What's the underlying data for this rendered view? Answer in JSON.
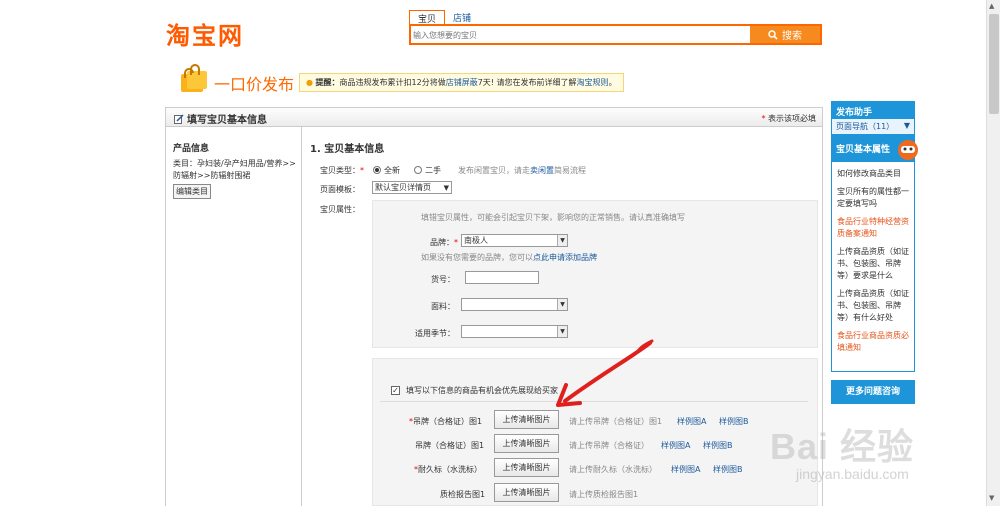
{
  "header": {
    "logo": "淘宝网",
    "tabs": [
      "宝贝",
      "店铺"
    ],
    "search_placeholder": "输入您想要的宝贝",
    "search_button": "搜索"
  },
  "title_bar": {
    "page_title": "一口价发布",
    "notice_bold": "提醒：",
    "notice_text1": "商品违规发布累计扣12分将做",
    "notice_link1": "店铺屏蔽",
    "notice_text2": "7天! 请您在发布前详细了解",
    "notice_link2": "淘宝规则",
    "notice_text3": "。"
  },
  "panel": {
    "title": "填写宝贝基本信息",
    "required_note": "表示该项必填"
  },
  "left": {
    "title": "产品信息",
    "category": "类目：孕妇装/孕产妇用品/营养>>防辐射>>防辐射围裙",
    "edit_button": "编辑类目"
  },
  "form": {
    "section_title": "1. 宝贝基本信息",
    "type_label": "宝贝类型：",
    "type_new": "全新",
    "type_used": "二手",
    "type_hint1": "发布闲置宝贝，请走",
    "type_hint_link": "卖闲置",
    "type_hint2": "简易流程",
    "template_label": "页面模板：",
    "template_value": "默认宝贝详情页",
    "attr_label": "宝贝属性：",
    "attr_hint": "填错宝贝属性，可能会引起宝贝下架，影响您的正常销售。请认真准确填写",
    "brand_label": "品牌：",
    "brand_value": "南极人",
    "brand_hint1": "如果没有您需要的品牌，您可以",
    "brand_hint_link": "点此申请添加品牌",
    "sku_label": "货号：",
    "fabric_label": "面料：",
    "season_label": "适用季节：",
    "priority_label": "填写以下信息的商品有机会优先展现给买家",
    "uploads": [
      {
        "label": "吊牌（合格证）图1",
        "required": true,
        "button": "上传清晰图片",
        "hint": "请上传吊牌（合格证）图1",
        "ex_a": "样例图A",
        "ex_b": "样例图B"
      },
      {
        "label": "吊牌（合格证）图1",
        "required": false,
        "button": "上传清晰图片",
        "hint": "请上传吊牌（合格证）",
        "ex_a": "样例图A",
        "ex_b": "样例图B"
      },
      {
        "label": "耐久标（水洗标）",
        "required": true,
        "button": "上传清晰图片",
        "hint": "请上传耐久标（水洗标）",
        "ex_a": "样例图A",
        "ex_b": "样例图B"
      },
      {
        "label": "质检报告图1",
        "required": false,
        "button": "上传清晰图片",
        "hint": "请上传质检报告图1",
        "ex_a": "",
        "ex_b": ""
      }
    ]
  },
  "sidebar": {
    "title": "发布助手",
    "nav_label": "页面导航（11）",
    "sub_title": "宝贝基本属性",
    "items": [
      {
        "text": "如何修改商品类目",
        "color": "#333333"
      },
      {
        "text": "宝贝所有的属性都一定要填写吗",
        "color": "#333333"
      },
      {
        "text": "食品行业特种经营资质备案通知",
        "color": "#e4571c"
      },
      {
        "text": "上传商品资质（如证书、包装图、吊牌等）要求是什么",
        "color": "#333333"
      },
      {
        "text": "上传商品资质（如证书、包装图、吊牌等）有什么好处",
        "color": "#333333"
      },
      {
        "text": "食品行业商品资质必填通知",
        "color": "#e4571c"
      }
    ],
    "more_help": "更多问题咨询"
  },
  "watermark": {
    "logo": "Bai 经验",
    "url": "jingyan.baidu.com"
  },
  "colors": {
    "brand_orange": "#ff5a00",
    "accent_blue": "#1d95d8",
    "link_blue": "#1c5a9c",
    "arrow_red": "#e0201c"
  }
}
